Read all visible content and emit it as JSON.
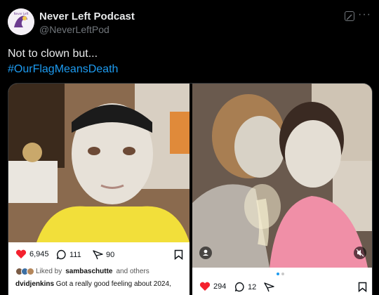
{
  "account": {
    "name": "Never Left Podcast",
    "handle": "@NeverLeftPod",
    "avatar_accent": "#6b3b8f"
  },
  "tweet": {
    "line1": "Not to clown but...",
    "hashtag": "#OurFlagMeansDeath",
    "hashtag_color": "#1d9bf0"
  },
  "left_post": {
    "likes": "6,945",
    "comments": "111",
    "shares": "90",
    "liked_by_prefix": "Liked by",
    "liked_by_user": "sambaschutte",
    "liked_by_suffix": "and others",
    "caption_user": "dvidjenkins",
    "caption_text": "Got a really good feeling about 2024,"
  },
  "right_post": {
    "likes": "294",
    "comments": "12"
  },
  "icons": {
    "grok": "grok-icon",
    "more": "more-icon",
    "heart": "heart-icon",
    "comment": "comment-icon",
    "share": "share-icon",
    "save": "bookmark-icon",
    "person": "person-tag-icon",
    "mute": "mute-icon"
  }
}
